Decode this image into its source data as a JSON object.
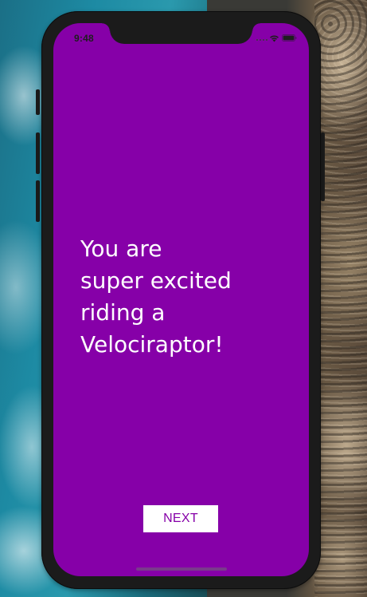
{
  "status_bar": {
    "time": "9:48",
    "icons": [
      "cellular-signal-icon",
      "wifi-icon",
      "battery-icon"
    ],
    "battery_level_percent": 100
  },
  "screen": {
    "background_color": "#8600a8",
    "message_lines": [
      "You are",
      "super excited",
      "riding a",
      "Velociraptor!"
    ]
  },
  "buttons": {
    "next_label": "NEXT"
  },
  "colors": {
    "accent": "#8600a8",
    "text": "#ffffff",
    "button_background": "#ffffff"
  }
}
